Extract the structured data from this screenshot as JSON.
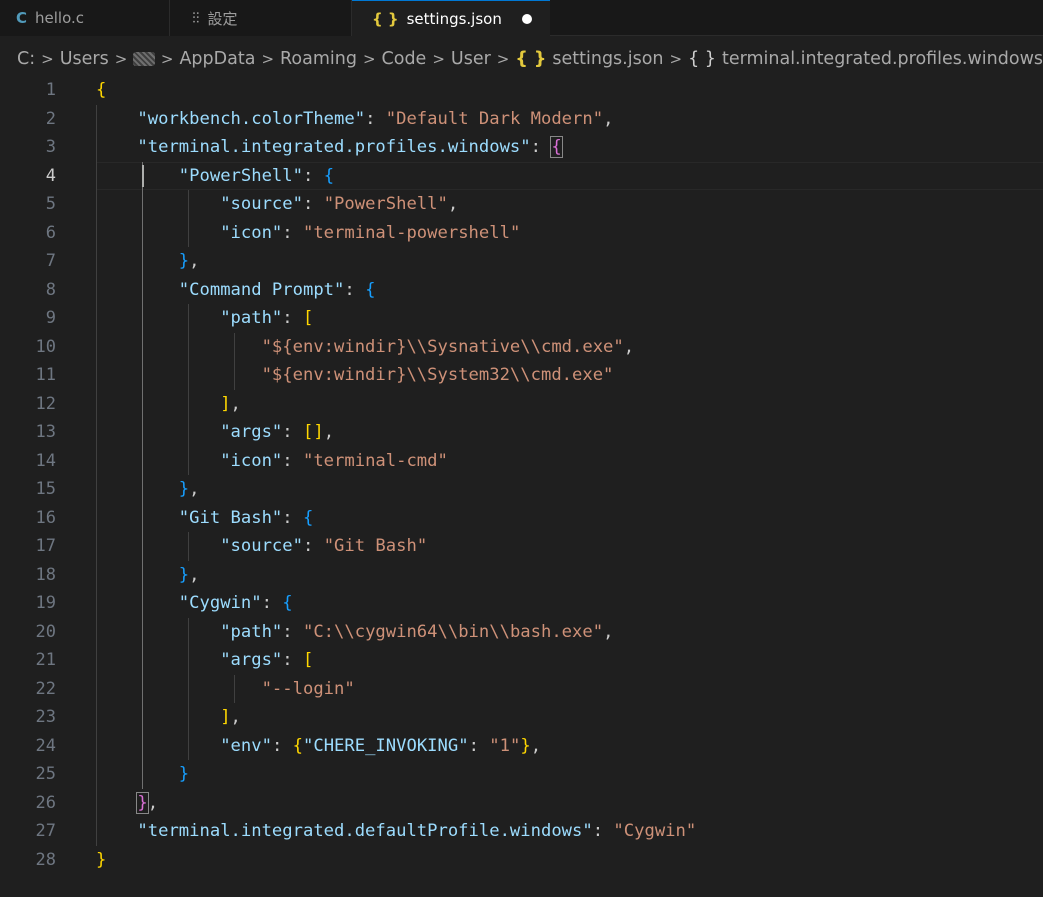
{
  "tabs": [
    {
      "label": "hello.c",
      "icon": "c-file-icon",
      "icon_text": "C"
    },
    {
      "label": "設定",
      "icon": "settings-sliders-icon",
      "icon_text": "⫶⫶"
    },
    {
      "label": "settings.json",
      "icon": "json-braces-icon",
      "icon_text": "{ }"
    }
  ],
  "breadcrumb": {
    "items": [
      "C:",
      "Users",
      "AppData",
      "Roaming",
      "Code",
      "User",
      "settings.json",
      "terminal.integrated.profiles.windows"
    ],
    "separator": ">",
    "json_icon_text": "{ }",
    "object_icon_text": "{ }"
  },
  "editor": {
    "current_line": 4,
    "lines": [
      [
        [
          "b1",
          "{"
        ]
      ],
      [
        [
          "p",
          "    "
        ],
        [
          "k",
          "\"workbench.colorTheme\""
        ],
        [
          "p",
          ": "
        ],
        [
          "s",
          "\"Default Dark Modern\""
        ],
        [
          "p",
          ","
        ]
      ],
      [
        [
          "p",
          "    "
        ],
        [
          "k",
          "\"terminal.integrated.profiles.windows\""
        ],
        [
          "p",
          ": "
        ],
        [
          "b2",
          "{"
        ]
      ],
      [
        [
          "p",
          "        "
        ],
        [
          "k",
          "\"PowerShell\""
        ],
        [
          "p",
          ": "
        ],
        [
          "b3",
          "{"
        ]
      ],
      [
        [
          "p",
          "            "
        ],
        [
          "k",
          "\"source\""
        ],
        [
          "p",
          ": "
        ],
        [
          "s",
          "\"PowerShell\""
        ],
        [
          "p",
          ","
        ]
      ],
      [
        [
          "p",
          "            "
        ],
        [
          "k",
          "\"icon\""
        ],
        [
          "p",
          ": "
        ],
        [
          "s",
          "\"terminal-powershell\""
        ]
      ],
      [
        [
          "p",
          "        "
        ],
        [
          "b3",
          "}"
        ],
        [
          "p",
          ","
        ]
      ],
      [
        [
          "p",
          "        "
        ],
        [
          "k",
          "\"Command Prompt\""
        ],
        [
          "p",
          ": "
        ],
        [
          "b3",
          "{"
        ]
      ],
      [
        [
          "p",
          "            "
        ],
        [
          "k",
          "\"path\""
        ],
        [
          "p",
          ": "
        ],
        [
          "b1",
          "["
        ]
      ],
      [
        [
          "p",
          "                "
        ],
        [
          "s",
          "\"${env:windir}\\\\Sysnative\\\\cmd.exe\""
        ],
        [
          "p",
          ","
        ]
      ],
      [
        [
          "p",
          "                "
        ],
        [
          "s",
          "\"${env:windir}\\\\System32\\\\cmd.exe\""
        ]
      ],
      [
        [
          "p",
          "            "
        ],
        [
          "b1",
          "]"
        ],
        [
          "p",
          ","
        ]
      ],
      [
        [
          "p",
          "            "
        ],
        [
          "k",
          "\"args\""
        ],
        [
          "p",
          ": "
        ],
        [
          "b1",
          "[]"
        ],
        [
          "p",
          ","
        ]
      ],
      [
        [
          "p",
          "            "
        ],
        [
          "k",
          "\"icon\""
        ],
        [
          "p",
          ": "
        ],
        [
          "s",
          "\"terminal-cmd\""
        ]
      ],
      [
        [
          "p",
          "        "
        ],
        [
          "b3",
          "}"
        ],
        [
          "p",
          ","
        ]
      ],
      [
        [
          "p",
          "        "
        ],
        [
          "k",
          "\"Git Bash\""
        ],
        [
          "p",
          ": "
        ],
        [
          "b3",
          "{"
        ]
      ],
      [
        [
          "p",
          "            "
        ],
        [
          "k",
          "\"source\""
        ],
        [
          "p",
          ": "
        ],
        [
          "s",
          "\"Git Bash\""
        ]
      ],
      [
        [
          "p",
          "        "
        ],
        [
          "b3",
          "}"
        ],
        [
          "p",
          ","
        ]
      ],
      [
        [
          "p",
          "        "
        ],
        [
          "k",
          "\"Cygwin\""
        ],
        [
          "p",
          ": "
        ],
        [
          "b3",
          "{"
        ]
      ],
      [
        [
          "p",
          "            "
        ],
        [
          "k",
          "\"path\""
        ],
        [
          "p",
          ": "
        ],
        [
          "s",
          "\"C:\\\\cygwin64\\\\bin\\\\bash.exe\""
        ],
        [
          "p",
          ","
        ]
      ],
      [
        [
          "p",
          "            "
        ],
        [
          "k",
          "\"args\""
        ],
        [
          "p",
          ": "
        ],
        [
          "b1",
          "["
        ]
      ],
      [
        [
          "p",
          "                "
        ],
        [
          "s",
          "\"--login\""
        ]
      ],
      [
        [
          "p",
          "            "
        ],
        [
          "b1",
          "]"
        ],
        [
          "p",
          ","
        ]
      ],
      [
        [
          "p",
          "            "
        ],
        [
          "k",
          "\"env\""
        ],
        [
          "p",
          ": "
        ],
        [
          "b1",
          "{"
        ],
        [
          "k",
          "\"CHERE_INVOKING\""
        ],
        [
          "p",
          ": "
        ],
        [
          "s",
          "\"1\""
        ],
        [
          "b1",
          "}"
        ],
        [
          "p",
          ","
        ]
      ],
      [
        [
          "p",
          "        "
        ],
        [
          "b3",
          "}"
        ]
      ],
      [
        [
          "p",
          "    "
        ],
        [
          "b2",
          "}"
        ],
        [
          "p",
          ","
        ]
      ],
      [
        [
          "p",
          "    "
        ],
        [
          "k",
          "\"terminal.integrated.defaultProfile.windows\""
        ],
        [
          "p",
          ": "
        ],
        [
          "s",
          "\"Cygwin\""
        ]
      ],
      [
        [
          "b1",
          "}"
        ]
      ]
    ]
  }
}
